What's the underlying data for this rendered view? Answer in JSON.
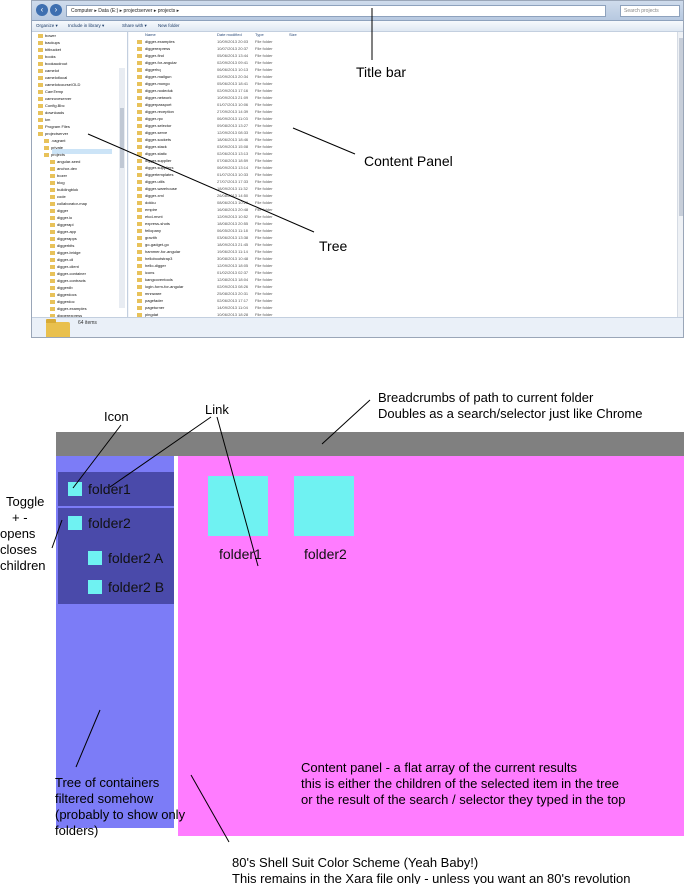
{
  "explorer": {
    "address": "Computer ▸ Data (E:) ▸ projectserver ▸ projects ▸",
    "search_placeholder": "Search projects",
    "toolbar": [
      "Organize ▾",
      "Include in library ▾",
      "Share with ▾",
      "New folder"
    ],
    "columns": [
      "Name",
      "Date modified",
      "Type",
      "Size"
    ],
    "tree_items": [
      "bower",
      "backups",
      "bitbucket",
      "books",
      "bookaudrout",
      "camelot",
      "camelotlocal",
      "camelotcourse/OLD",
      "CamTemp",
      "camroveserver",
      "Config.Bbc",
      "downloads",
      "km",
      "Program Files",
      "projectserver",
      ".vagrant",
      "private",
      "projects",
      "angular-seed",
      "anchor-dev",
      "bozer",
      "blog",
      "buildingblok",
      "code",
      "collaborator-map",
      "digger",
      "digger.io",
      "diggerapi",
      "digger-app",
      "diggerapps",
      "diggerbits",
      "digger-bridge",
      "digger-cli",
      "digger-client",
      "digger-container",
      "digger-contracts",
      "diggerdb",
      "diggerdocs",
      "diggerdoc",
      "digger-examples",
      "diggerexpress"
    ],
    "content_items": [
      {
        "name": "digger-examples",
        "date": "10/09/2013 20:03",
        "type": "File folder"
      },
      {
        "name": "diggerexpress",
        "date": "10/07/2013 20:37",
        "type": "File folder"
      },
      {
        "name": "digger-find",
        "date": "05/06/2013 13:44",
        "type": "File folder"
      },
      {
        "name": "digger-for-angular",
        "date": "02/09/2013 09:41",
        "type": "File folder"
      },
      {
        "name": "diggerhq",
        "date": "06/06/2013 10:13",
        "type": "File folder"
      },
      {
        "name": "digger-mailgun",
        "date": "02/09/2013 20:34",
        "type": "File folder"
      },
      {
        "name": "digger-mongo",
        "date": "05/06/2013 18:41",
        "type": "File folder"
      },
      {
        "name": "digger-nodeduk",
        "date": "02/09/2013 17:16",
        "type": "File folder"
      },
      {
        "name": "digger-network",
        "date": "10/09/2013 21:09",
        "type": "File folder"
      },
      {
        "name": "diggerpassport",
        "date": "01/07/2013 10:06",
        "type": "File folder"
      },
      {
        "name": "digger-reception",
        "date": "27/09/2013 14:39",
        "type": "File folder"
      },
      {
        "name": "digger-rpc",
        "date": "06/09/2013 11:03",
        "type": "File folder"
      },
      {
        "name": "digger-selector",
        "date": "09/08/2013 13:27",
        "type": "File folder"
      },
      {
        "name": "digger-serve",
        "date": "12/09/2013 08:33",
        "type": "File folder"
      },
      {
        "name": "digger-sockets",
        "date": "18/06/2013 18:46",
        "type": "File folder"
      },
      {
        "name": "digger-stack",
        "date": "03/09/2013 15:08",
        "type": "File folder"
      },
      {
        "name": "digger-static",
        "date": "02/06/2013 13:13",
        "type": "File folder"
      },
      {
        "name": "digger-supplier",
        "date": "07/08/2013 18:59",
        "type": "File folder"
      },
      {
        "name": "digger-suppliers",
        "date": "06/09/2013 13:14",
        "type": "File folder"
      },
      {
        "name": "diggertemplates",
        "date": "01/07/2013 10:33",
        "type": "File folder"
      },
      {
        "name": "digger-utils",
        "date": "27/07/2013 17:33",
        "type": "File folder"
      },
      {
        "name": "digger-warehouse",
        "date": "18/09/2013 11:32",
        "type": "File folder"
      },
      {
        "name": "digger-xml",
        "date": "26/08/2013 14:50",
        "type": "File folder"
      },
      {
        "name": "dokku",
        "date": "08/06/2013 10:20",
        "type": "File folder"
      },
      {
        "name": "empire",
        "date": "16/08/2013 20:48",
        "type": "File folder"
      },
      {
        "name": "etcd-mvnt",
        "date": "12/09/2013 10:52",
        "type": "File folder"
      },
      {
        "name": "express-shots",
        "date": "18/08/2013 20:55",
        "type": "File folder"
      },
      {
        "name": "fellopany",
        "date": "06/05/2013 11:18",
        "type": "File folder"
      },
      {
        "name": "gravith",
        "date": "03/06/2013 13:38",
        "type": "File folder"
      },
      {
        "name": "go-gadget-go",
        "date": "18/09/2013 21:45",
        "type": "File folder"
      },
      {
        "name": "hammer-for-angular",
        "date": "19/06/2013 11:14",
        "type": "File folder"
      },
      {
        "name": "hellobootstrap3",
        "date": "30/08/2013 10:48",
        "type": "File folder"
      },
      {
        "name": "hello-digger",
        "date": "12/09/2013 18:05",
        "type": "File folder"
      },
      {
        "name": "icons",
        "date": "01/02/2013 02:37",
        "type": "File folder"
      },
      {
        "name": "kangcoventools",
        "date": "12/08/2013 18:04",
        "type": "File folder"
      },
      {
        "name": "login-form-for-angular",
        "date": "02/09/2013 08:26",
        "type": "File folder"
      },
      {
        "name": "mnnware",
        "date": "25/08/2013 20:31",
        "type": "File folder"
      },
      {
        "name": "pagefader",
        "date": "02/06/2013 17:17",
        "type": "File folder"
      },
      {
        "name": "pageturner",
        "date": "14/09/2013 11:04",
        "type": "File folder"
      },
      {
        "name": "pingdat",
        "date": "10/06/2013 18:28",
        "type": "File folder"
      }
    ],
    "status": "64 items"
  },
  "wireframe": {
    "tree_nodes": [
      "folder1",
      "folder2",
      "folder2 A",
      "folder2 B"
    ],
    "content_tiles": [
      "folder1",
      "folder2"
    ],
    "colors": {
      "bar": "#808080",
      "tree": "#7c7cf7",
      "content": "#ff7cff",
      "node": "#4a4aaa",
      "icon": "#6ff2f2"
    }
  },
  "annotations": {
    "title_bar": "Title bar",
    "content_panel": "Content Panel",
    "tree": "Tree",
    "breadcrumbs": [
      "Breadcrumbs of path to current folder",
      "Doubles as a search/selector just like Chrome"
    ],
    "icon": "Icon",
    "link": "Link",
    "toggle": [
      "Toggle",
      "+ -",
      "opens",
      "closes",
      "children"
    ],
    "tree_desc": [
      "Tree of containers",
      "filtered somehow",
      "(probably to show only",
      "folders)"
    ],
    "content_desc": [
      "Content panel - a flat array of the current results",
      "this is either the children of the selected item in the tree",
      "or the result of the search / selector they typed in the top"
    ],
    "color_scheme": [
      "80's Shell Suit Color Scheme (Yeah Baby!)",
      "This remains in the Xara file only - unless you want an 80's revolution"
    ]
  }
}
